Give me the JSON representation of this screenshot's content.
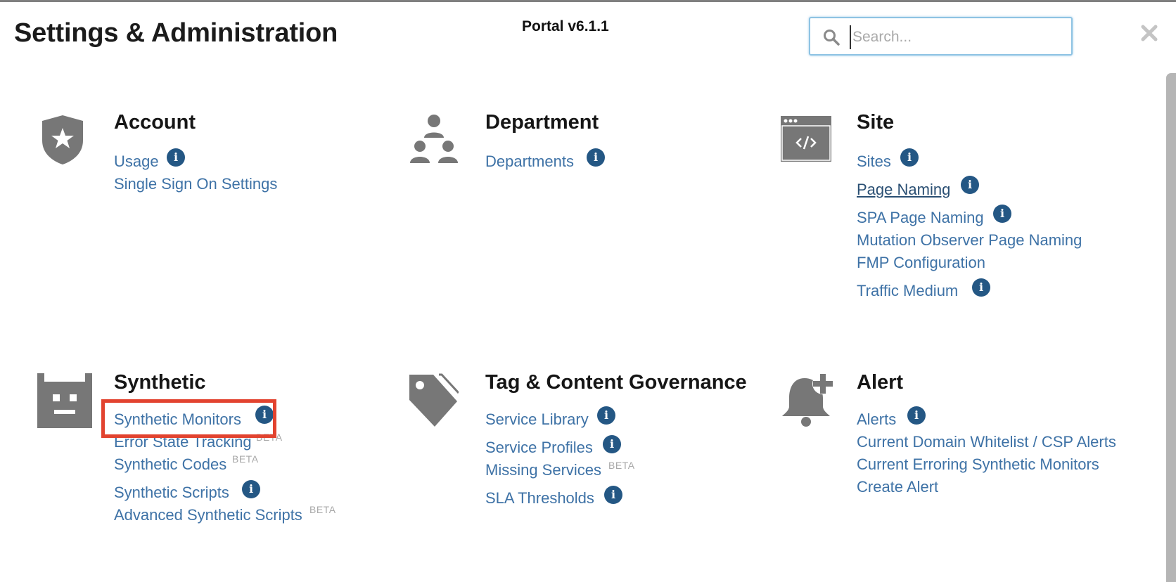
{
  "header": {
    "title": "Settings & Administration",
    "version": "Portal v6.1.1",
    "search_placeholder": "Search...",
    "search_value": ""
  },
  "icons": {
    "search": "search-icon",
    "close": "close-icon",
    "info": "info-icon",
    "account": "shield-star-icon",
    "department": "org-chart-icon",
    "site": "browser-code-icon",
    "synthetic": "robot-icon",
    "tag": "tag-icon",
    "alert": "bell-plus-icon"
  },
  "colors": {
    "link": "#3e72a6",
    "info_badge": "#245784",
    "icon_gray": "#777777",
    "highlight": "#e2432f"
  },
  "info_glyph": "i",
  "beta_label": "BETA",
  "sections": {
    "account": {
      "title": "Account",
      "links": [
        "Usage",
        "Single Sign On Settings"
      ]
    },
    "department": {
      "title": "Department",
      "links": [
        "Departments"
      ]
    },
    "site": {
      "title": "Site",
      "links": [
        "Sites",
        "Page Naming",
        "SPA Page Naming",
        "Mutation Observer Page Naming",
        "FMP Configuration",
        "Traffic Medium"
      ]
    },
    "synthetic": {
      "title": "Synthetic",
      "links": [
        "Synthetic Monitors",
        "Error State Tracking",
        "Synthetic Codes",
        "Synthetic Scripts",
        "Advanced Synthetic Scripts"
      ]
    },
    "tag": {
      "title": "Tag & Content Governance",
      "links": [
        "Service Library",
        "Service Profiles",
        "Missing Services",
        "SLA Thresholds"
      ]
    },
    "alert": {
      "title": "Alert",
      "links": [
        "Alerts",
        "Current Domain Whitelist / CSP Alerts",
        "Current Erroring Synthetic Monitors",
        "Create Alert"
      ]
    }
  }
}
